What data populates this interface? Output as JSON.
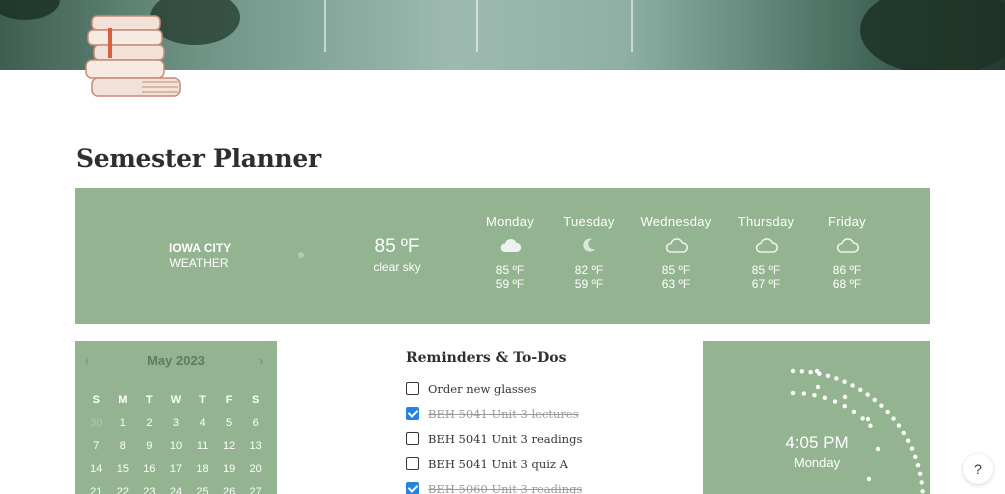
{
  "page": {
    "title": "Semester Planner"
  },
  "weather": {
    "city": "IOWA CITY",
    "label": "WEATHER",
    "current": {
      "temp": "85 ºF",
      "desc": "clear sky"
    },
    "days": [
      {
        "name": "Monday",
        "icon": "cloud-icon",
        "high": "85 ºF",
        "low": "59 ºF"
      },
      {
        "name": "Tuesday",
        "icon": "moon-icon",
        "high": "82 ºF",
        "low": "59 ºF"
      },
      {
        "name": "Wednesday",
        "icon": "cloud-icon",
        "high": "85 ºF",
        "low": "63 ºF"
      },
      {
        "name": "Thursday",
        "icon": "cloud-icon",
        "high": "85 ºF",
        "low": "67 ºF"
      },
      {
        "name": "Friday",
        "icon": "cloud-icon",
        "high": "86 ºF",
        "low": "68 ºF"
      }
    ]
  },
  "calendar": {
    "month": "May 2023",
    "prev": "‹",
    "next": "›",
    "weekdays": [
      "S",
      "M",
      "T",
      "W",
      "T",
      "F",
      "S"
    ],
    "weeks": [
      [
        "30",
        "1",
        "2",
        "3",
        "4",
        "5",
        "6"
      ],
      [
        "7",
        "8",
        "9",
        "10",
        "11",
        "12",
        "13"
      ],
      [
        "14",
        "15",
        "16",
        "17",
        "18",
        "19",
        "20"
      ],
      [
        "21",
        "22",
        "23",
        "24",
        "25",
        "26",
        "27"
      ]
    ],
    "muted": [
      "30"
    ]
  },
  "todos": {
    "title": "Reminders & To-Dos",
    "items": [
      {
        "label": "Order new glasses",
        "done": false
      },
      {
        "label": "BEH 5041 Unit 3 lectures",
        "done": true
      },
      {
        "label": "BEH 5041 Unit 3 readings",
        "done": false
      },
      {
        "label": "BEH 5041 Unit 3 quiz A",
        "done": false
      },
      {
        "label": "BEH 5060 Unit 3 readings",
        "done": true
      }
    ]
  },
  "clock": {
    "time": "4:05 PM",
    "day": "Monday"
  },
  "help": {
    "label": "?"
  },
  "colors": {
    "widget_bg": "#93b391",
    "checkbox_on": "#2383e2",
    "calendar_accent": "#5b7e5c"
  }
}
